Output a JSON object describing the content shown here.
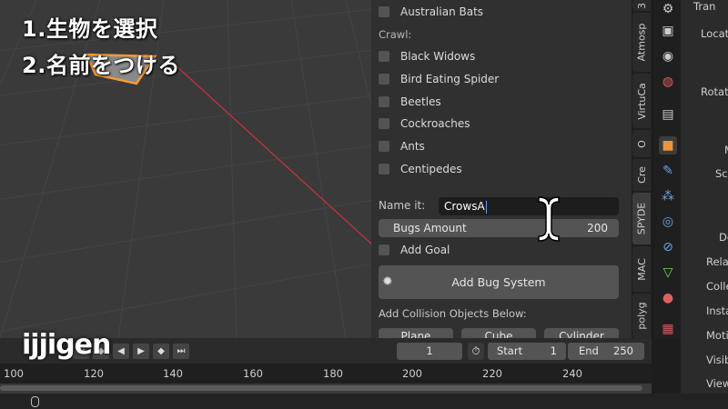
{
  "overlay": {
    "line1": "1.生物を選択",
    "line2": "2.名前をつける"
  },
  "npanel": {
    "checkbox_top": {
      "label": "Australian Bats",
      "checked": false
    },
    "crawl_label": "Crawl:",
    "crawl_items": [
      {
        "label": "Black Widows",
        "checked": false
      },
      {
        "label": "Bird Eating Spider",
        "checked": false
      },
      {
        "label": "Beetles",
        "checked": false
      },
      {
        "label": "Cockroaches",
        "checked": false
      },
      {
        "label": "Ants",
        "checked": false
      },
      {
        "label": "Centipedes",
        "checked": false
      }
    ],
    "name_label": "Name it:",
    "name_value": "CrowsA",
    "bugs_amount_label": "Bugs Amount",
    "bugs_amount_value": "200",
    "add_goal_label": "Add Goal",
    "add_bug_system_label": "Add Bug System",
    "collision_label": "Add Collision Objects Below:",
    "collision_buttons": [
      "Plane",
      "Cube",
      "Cylinder"
    ]
  },
  "vtabs": [
    "3",
    "Atmosp",
    "VirtuCa",
    "O",
    "Cre",
    "SPYDE",
    "MAC",
    "polyg"
  ],
  "propanel": {
    "labels": [
      "Tran",
      "Locati",
      "Rotati",
      "M",
      "Sca",
      "De",
      "Rela",
      "Colle",
      "Insta",
      "Motio",
      "Visib",
      "View"
    ]
  },
  "timeline": {
    "current_frame": "1",
    "start_label": "Start",
    "start_value": "1",
    "end_label": "End",
    "end_value": "250",
    "ticks": [
      "100",
      "120",
      "140",
      "160",
      "180",
      "200",
      "220",
      "240"
    ]
  },
  "logo": "ijjigen",
  "colors": {
    "accent_selected": "#ff9933",
    "red_axis": "#c0323c",
    "caret": "#5fa3ff"
  }
}
